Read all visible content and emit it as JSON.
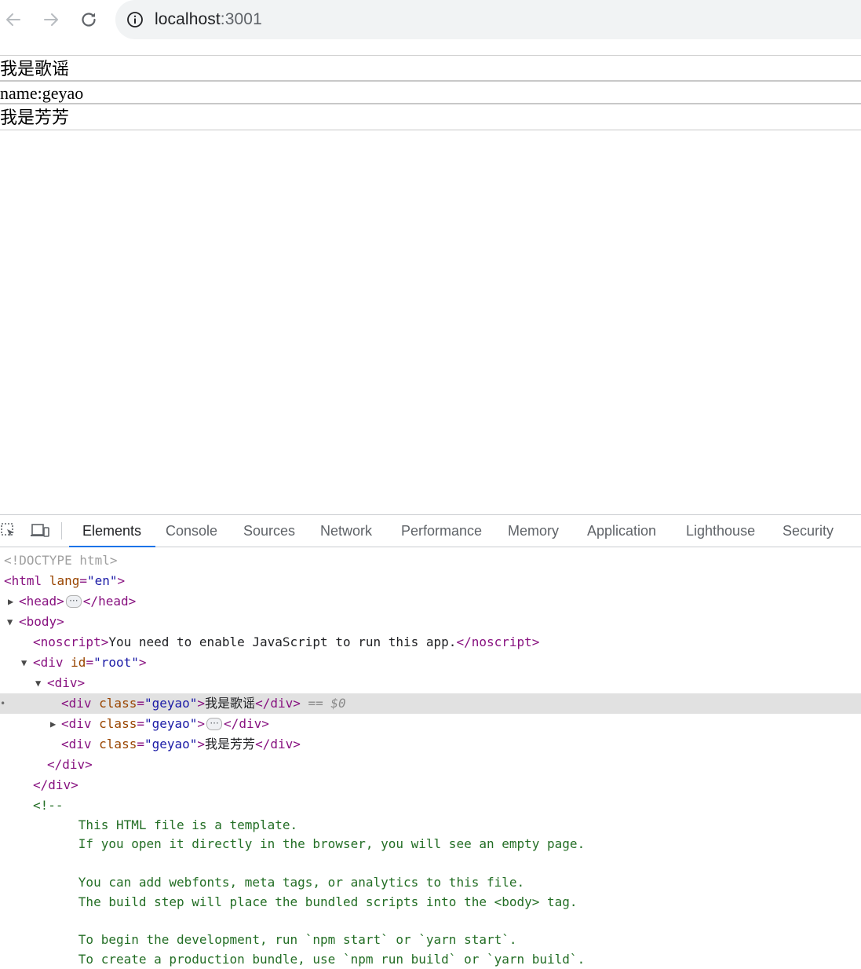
{
  "browser": {
    "url_host": "localhost",
    "url_port": ":3001"
  },
  "page": {
    "lines": [
      "我是歌谣",
      "name:geyao",
      "我是芳芳"
    ]
  },
  "devtools": {
    "tabs": [
      "Elements",
      "Console",
      "Sources",
      "Network",
      "Performance",
      "Memory",
      "Application",
      "Lighthouse",
      "Security"
    ],
    "active_tab": "Elements",
    "dom": {
      "doctype": "<!DOCTYPE html>",
      "html_open": "<html",
      "html_attr": " lang",
      "html_val": "\"en\"",
      "gt": ">",
      "head_open": "<head>",
      "head_close": "</head>",
      "body_open": "<body>",
      "noscript_open": "<noscript>",
      "noscript_text": "You need to enable JavaScript to run this app.",
      "noscript_close": "</noscript>",
      "div_root_open": "<div",
      "id_attr": " id",
      "root_val": "\"root\"",
      "div_open": "<div>",
      "div_tag": "<div",
      "class_attr": " class",
      "class_val": "\"geyao\"",
      "child1_text": "我是歌谣",
      "child3_text": "我是芳芳",
      "div_close": "</div>",
      "selected_marker": " == $0",
      "comment_open": "<!--",
      "comment_lines": [
        "      This HTML file is a template.",
        "      If you open it directly in the browser, you will see an empty page.",
        "",
        "      You can add webfonts, meta tags, or analytics to this file.",
        "      The build step will place the bundled scripts into the <body> tag.",
        "",
        "      To begin the development, run `npm start` or `yarn start`.",
        "      To create a production bundle, use `npm run build` or `yarn build`."
      ]
    }
  }
}
